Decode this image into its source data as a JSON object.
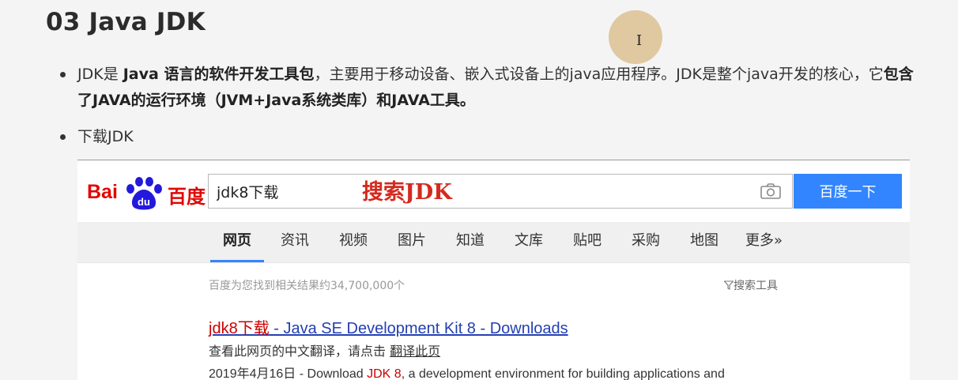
{
  "heading": "03 Java JDK",
  "bullet1": {
    "t1": "JDK是 ",
    "b1": "Java 语言的软件开发工具包",
    "t2": "，主要用于移动设备、嵌入式设备上的java应用程序。JDK是整个java开发的核心，它",
    "b2": "包含了JAVA的运行环境（JVM+Java系统类库）和JAVA工具。"
  },
  "bullet2": "下载JDK",
  "baidu": {
    "logo_bai": "Bai",
    "logo_du": "du",
    "logo_cn": "百度",
    "search_value": "jdk8下载",
    "annotation": "搜索JDK",
    "search_button": "百度一下",
    "tabs": [
      "网页",
      "资讯",
      "视频",
      "图片",
      "知道",
      "文库",
      "贴吧",
      "采购",
      "地图",
      "更多»"
    ],
    "result_count": "百度为您找到相关结果约34,700,000个",
    "search_tools": "搜索工具",
    "result": {
      "title_em": "jdk8下载",
      "title_rest": " - Java SE Development Kit 8 - Downloads",
      "translate_prefix": "查看此网页的中文翻译，请点击 ",
      "translate_link": "翻译此页",
      "snippet_date": "2019年4月16日 - Download ",
      "snippet_em": "JDK 8",
      "snippet_rest": ", a development environment for building applications and"
    }
  },
  "colors": {
    "brand_red": "#e10602",
    "baidu_blue": "#3385ff",
    "link_blue": "#2440b3",
    "annotation_red": "#d42a1f"
  }
}
